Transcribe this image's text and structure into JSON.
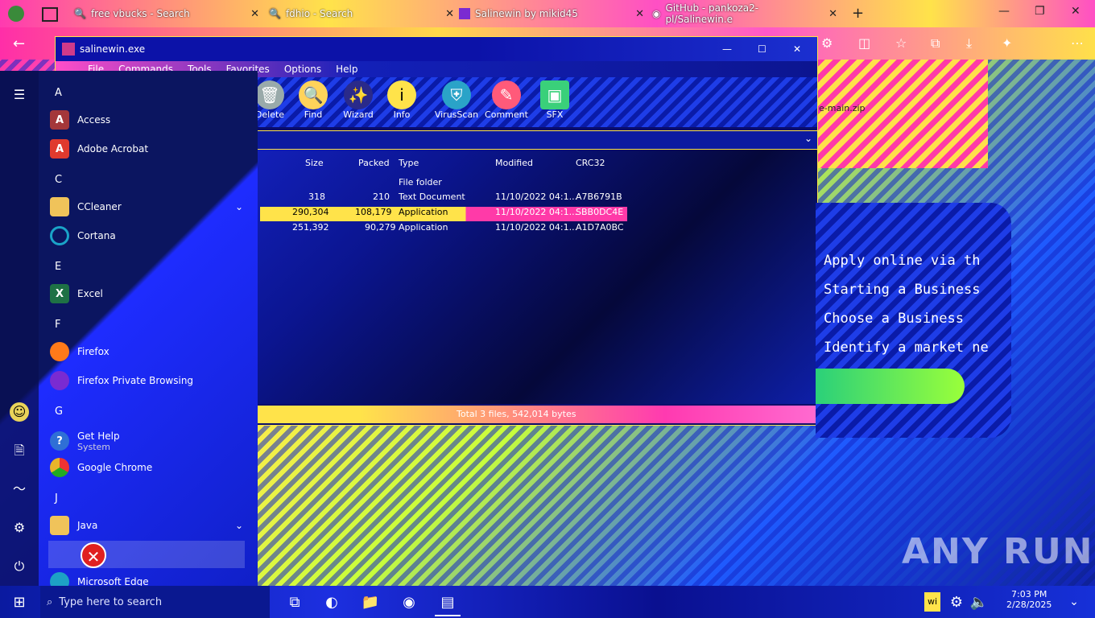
{
  "tabs": [
    {
      "label": "free vbucks - Search"
    },
    {
      "label": "fdhio - Search"
    },
    {
      "label": "Salinewin by mikid45"
    },
    {
      "label": "GitHub - pankoza2-pl/Salinewin.e"
    }
  ],
  "window": {
    "title": "salinewin.exe",
    "menu": [
      "File",
      "Commands",
      "Tools",
      "Favorites",
      "Options",
      "Help"
    ],
    "toolbar": [
      "Delete",
      "Find",
      "Wizard",
      "Info",
      "VirusScan",
      "Comment",
      "SFX"
    ],
    "columns": [
      "Size",
      "Packed",
      "Type",
      "Modified",
      "CRC32"
    ],
    "rows": [
      {
        "size": "",
        "packed": "",
        "type": "File folder",
        "modified": "",
        "crc": ""
      },
      {
        "size": "318",
        "packed": "210",
        "type": "Text Document",
        "modified": "11/10/2022 04:1...",
        "crc": "A7B6791B"
      },
      {
        "size": "290,304",
        "packed": "108,179",
        "type": "Application",
        "modified": "11/10/2022 04:1...",
        "crc": "SBB0DC4E"
      },
      {
        "size": "251,392",
        "packed": "90,279",
        "type": "Application",
        "modified": "11/10/2022 04:1...",
        "crc": "A1D7A0BC"
      }
    ],
    "status": "Total 3 files, 542,014 bytes"
  },
  "address_fragment": "e-main.zip",
  "panel": {
    "lines": [
      "Apply online via th",
      "Starting a Business",
      "Choose a Business",
      "Identify a market ne"
    ]
  },
  "start_menu": {
    "letters": [
      "A",
      "C",
      "E",
      "F",
      "G",
      "J"
    ],
    "apps": [
      {
        "label": "Access",
        "icon": "A",
        "color": "#a4373a"
      },
      {
        "label": "Adobe Acrobat",
        "icon": "A",
        "color": "#e03a2e"
      },
      {
        "label": "CCleaner",
        "icon": "",
        "color": "#f0c35a"
      },
      {
        "label": "Cortana",
        "icon": "",
        "color": "#1aa3c8"
      },
      {
        "label": "Excel",
        "icon": "X",
        "color": "#1e7145"
      },
      {
        "label": "Firefox",
        "icon": "",
        "color": "#ff7a1a"
      },
      {
        "label": "Firefox Private Browsing",
        "icon": "",
        "color": "#7a2bd1"
      },
      {
        "label": "Get Help",
        "icon": "?",
        "color": "#2f6fd6"
      },
      {
        "label": "System",
        "icon": "",
        "color": ""
      },
      {
        "label": "Google Chrome",
        "icon": "",
        "color": "#e9b52a"
      },
      {
        "label": "Java",
        "icon": "",
        "color": "#f0c35a"
      },
      {
        "label": "Microsoft Edge",
        "icon": "",
        "color": "#1da1c5"
      }
    ]
  },
  "taskbar": {
    "search_placeholder": "Type here to search",
    "tray_text": "wi",
    "clock_time": "7:03 PM",
    "clock_date": "2/28/2025"
  },
  "watermark": "ANY RUN"
}
